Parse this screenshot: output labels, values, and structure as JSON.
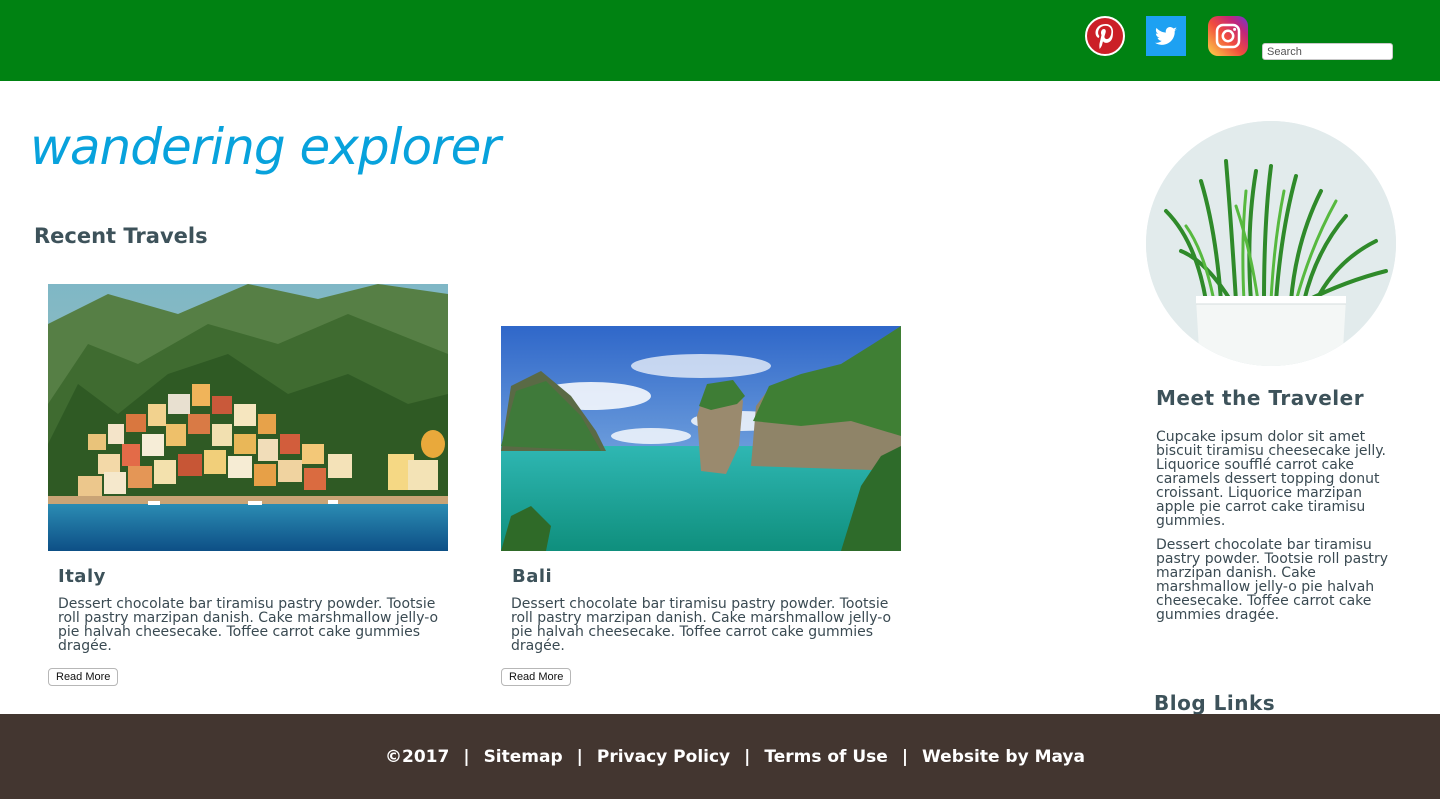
{
  "header": {
    "social": [
      {
        "name": "pinterest-icon",
        "color": "#cb1f27"
      },
      {
        "name": "twitter-icon",
        "color": "#1da1f2"
      },
      {
        "name": "instagram-icon",
        "color": "#c13584"
      }
    ],
    "search_placeholder": "Search",
    "background": "#008212"
  },
  "logo": {
    "text": "wandering explorer",
    "color": "#08a2dc"
  },
  "main": {
    "section_title": "Recent Travels",
    "cards": [
      {
        "title": "Italy",
        "text": "Dessert chocolate bar tiramisu pastry powder. Tootsie roll pastry marzipan danish. Cake marshmallow jelly-o pie halvah cheesecake. Toffee carrot cake gummies dragée.",
        "button": "Read More"
      },
      {
        "title": "Bali",
        "text": "Dessert chocolate bar tiramisu pastry powder. Tootsie roll pastry marzipan danish. Cake marshmallow jelly-o pie halvah cheesecake. Toffee carrot cake gummies dragée.",
        "button": "Read More"
      }
    ]
  },
  "sidebar": {
    "title": "Meet the Traveler",
    "paragraphs": [
      "Cupcake ipsum dolor sit amet biscuit tiramisu cheesecake jelly. Liquorice soufflé carrot cake caramels dessert topping donut croissant. Liquorice marzipan apple pie carrot cake tiramisu gummies.",
      "Dessert chocolate bar tiramisu pastry powder. Tootsie roll pastry marzipan danish. Cake marshmallow jelly-o pie halvah cheesecake. Toffee carrot cake gummies dragée."
    ],
    "blog_links_title": "Blog Links"
  },
  "footer": {
    "copyright": "©2017",
    "separator": "|",
    "links": [
      "Sitemap",
      "Privacy Policy",
      "Terms of Use"
    ],
    "credit": "Website by Maya",
    "background": "#433630"
  }
}
